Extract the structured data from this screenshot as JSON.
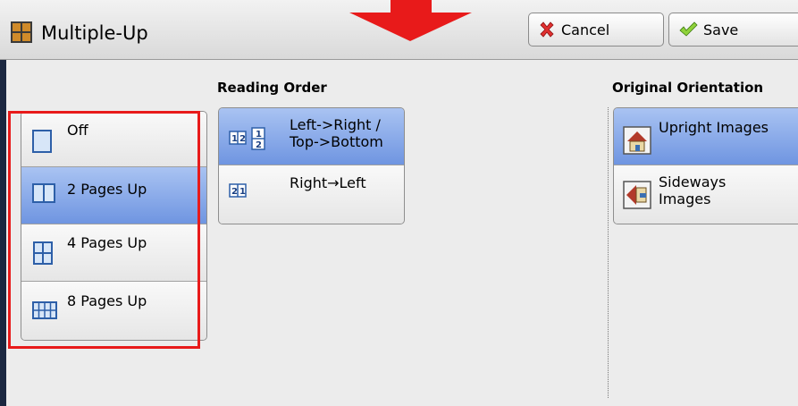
{
  "header": {
    "title": "Multiple-Up",
    "cancel_label": "Cancel",
    "save_label": "Save"
  },
  "pages_up": {
    "items": [
      {
        "label": "Off",
        "selected": false
      },
      {
        "label": "2 Pages Up",
        "selected": true
      },
      {
        "label": "4 Pages Up",
        "selected": false
      },
      {
        "label": "8 Pages Up",
        "selected": false
      }
    ]
  },
  "reading_order": {
    "title": "Reading Order",
    "items": [
      {
        "label": "Left->Right / Top->Bottom",
        "line1": "Left->Right /",
        "line2": "Top->Bottom",
        "selected": true
      },
      {
        "label": "Right→Left",
        "selected": false
      }
    ]
  },
  "original_orientation": {
    "title": "Original Orientation",
    "items": [
      {
        "label": "Upright Images",
        "selected": true
      },
      {
        "label": "Sideways Images",
        "line1": "Sideways",
        "line2": "Images",
        "selected": false
      }
    ]
  },
  "colors": {
    "selected_top": "#a9c3f2",
    "selected_bottom": "#6f95e1",
    "highlight_box": "#e81a1a",
    "arrow": "#e81a1a"
  }
}
